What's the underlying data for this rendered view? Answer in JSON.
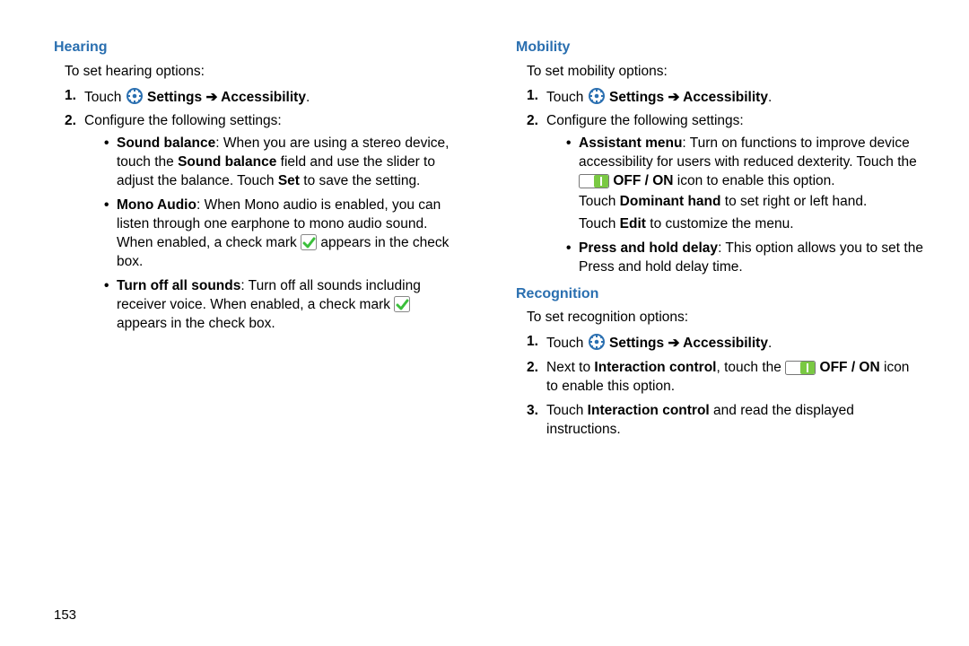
{
  "page_number": "153",
  "nav": {
    "touch": "Touch",
    "settings_acc": "Settings ➔ Accessibility",
    "configure": "Configure the following settings:"
  },
  "hearing": {
    "title": "Hearing",
    "intro": "To set hearing options:",
    "items": {
      "sound_balance": {
        "label": "Sound balance",
        "t1": ": When you are using a stereo device, touch the ",
        "label2": "Sound balance",
        "t2": " field and use the slider to adjust the balance. Touch ",
        "set": "Set",
        "t3": " to save the setting."
      },
      "mono": {
        "label": "Mono Audio",
        "t1": ": When Mono audio is enabled, you can listen through one earphone to mono audio sound. When enabled, a check mark ",
        "t2": " appears in the check box."
      },
      "turnoff": {
        "label": "Turn off all sounds",
        "t1": ": Turn off all sounds including receiver voice. When enabled, a check mark ",
        "t2": " appears in the check box."
      }
    }
  },
  "mobility": {
    "title": "Mobility",
    "intro": "To set mobility options:",
    "items": {
      "assistant": {
        "label": "Assistant menu",
        "t1": ": Turn on functions to improve device accessibility for users with reduced dexterity. Touch the ",
        "offon": "OFF / ON",
        "t2": " icon to enable this option.",
        "sub1a": "Touch ",
        "sub1b": "Dominant hand",
        "sub1c": " to set right or left hand.",
        "sub2a": "Touch ",
        "sub2b": "Edit",
        "sub2c": " to customize the menu."
      },
      "presshold": {
        "label": "Press and hold delay",
        "t1": ": This option allows you to set the Press and hold delay time."
      }
    }
  },
  "recognition": {
    "title": "Recognition",
    "intro": "To set recognition options:",
    "step2a": "Next to ",
    "step2b": "Interaction control",
    "step2c": ", touch the ",
    "offon": "OFF / ON",
    "step2d": " icon to enable this option.",
    "step3a": "Touch ",
    "step3b": "Interaction control",
    "step3c": " and read the displayed instructions."
  }
}
